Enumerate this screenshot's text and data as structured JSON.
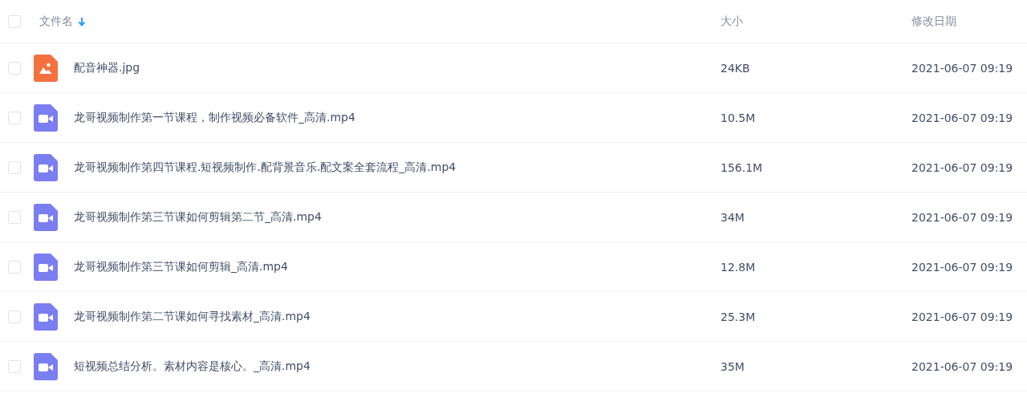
{
  "header": {
    "checked": false,
    "name": "文件名",
    "size": "大小",
    "date": "修改日期"
  },
  "files": [
    {
      "kind": "image",
      "name": "配音神器.jpg",
      "size": "24KB",
      "date": "2021-06-07 09:19",
      "checked": false
    },
    {
      "kind": "video",
      "name": "龙哥视频制作第一节课程，制作视频必备软件_高清.mp4",
      "size": "10.5M",
      "date": "2021-06-07 09:19",
      "checked": false
    },
    {
      "kind": "video",
      "name": "龙哥视频制作第四节课程.短视频制作.配背景音乐.配文案全套流程_高清.mp4",
      "size": "156.1M",
      "date": "2021-06-07 09:19",
      "checked": false
    },
    {
      "kind": "video",
      "name": "龙哥视频制作第三节课如何剪辑第二节_高清.mp4",
      "size": "34M",
      "date": "2021-06-07 09:19",
      "checked": false
    },
    {
      "kind": "video",
      "name": "龙哥视频制作第三节课如何剪辑_高清.mp4",
      "size": "12.8M",
      "date": "2021-06-07 09:19",
      "checked": false
    },
    {
      "kind": "video",
      "name": "龙哥视频制作第二节课如何寻找素材_高清.mp4",
      "size": "25.3M",
      "date": "2021-06-07 09:19",
      "checked": false
    },
    {
      "kind": "video",
      "name": "短视频总结分析。素材内容是核心。_高清.mp4",
      "size": "35M",
      "date": "2021-06-07 09:19",
      "checked": false
    }
  ]
}
